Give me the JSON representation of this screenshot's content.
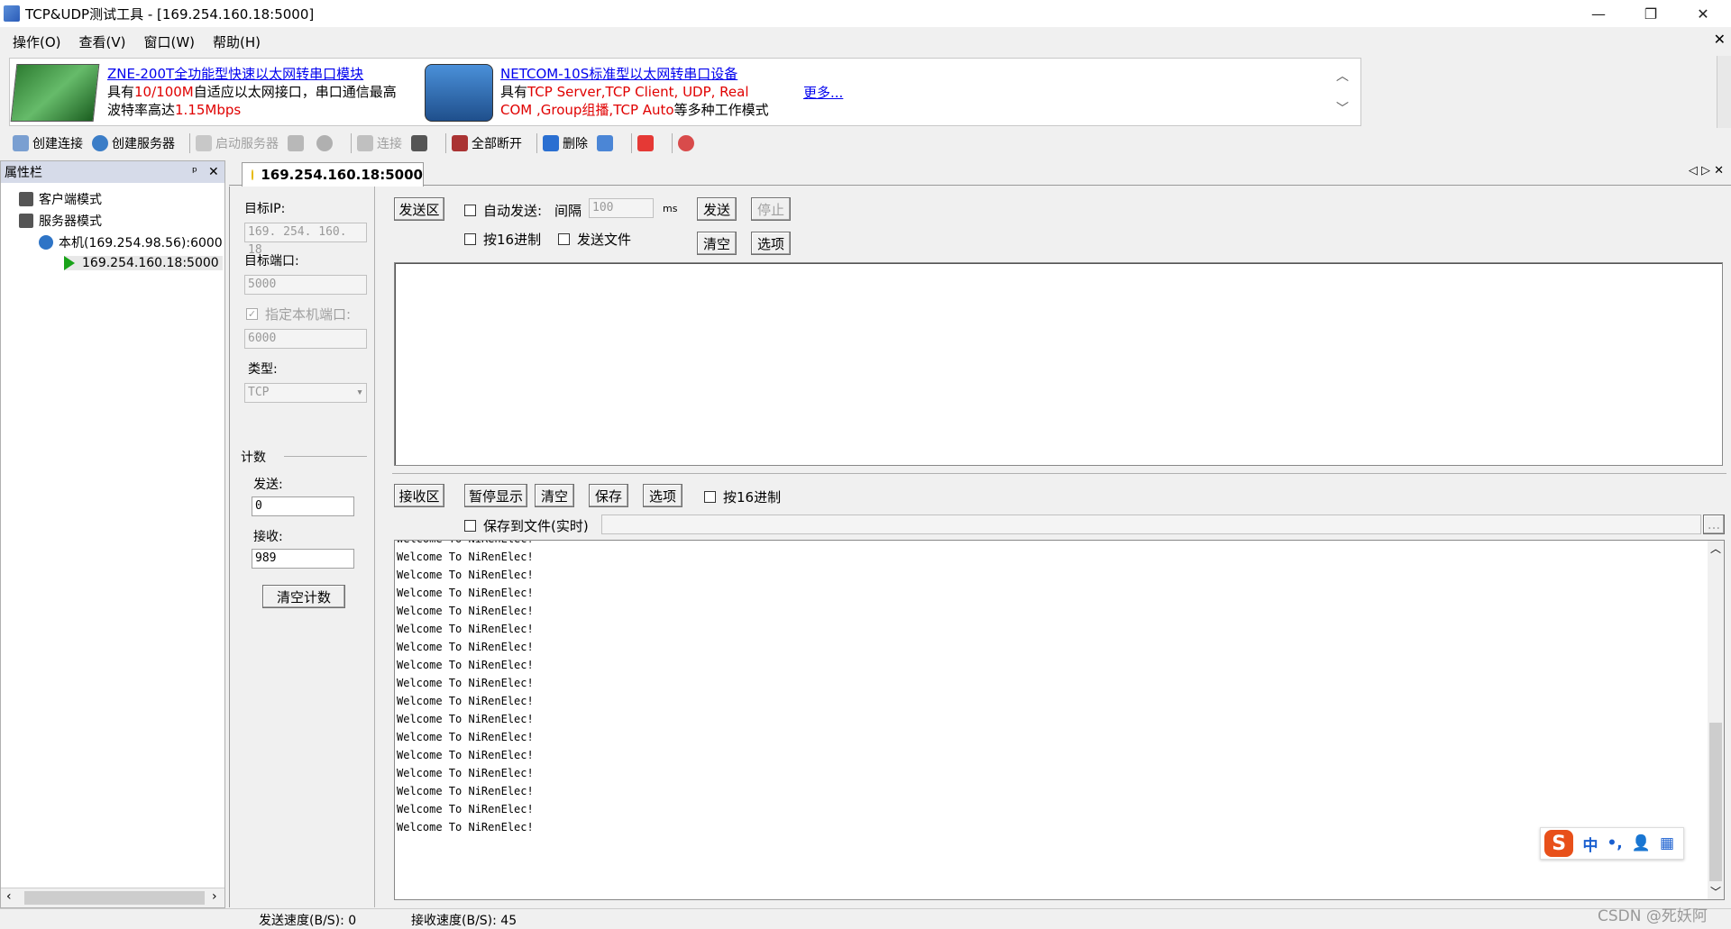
{
  "window": {
    "title": "TCP&UDP测试工具 - [169.254.160.18:5000]",
    "minimize": "—",
    "restore": "❐",
    "close": "✕"
  },
  "menu": {
    "items": [
      "操作(O)",
      "查看(V)",
      "窗口(W)",
      "帮助(H)"
    ],
    "mdi_close": "✕"
  },
  "ads": {
    "ad1_title": "ZNE-200T全功能型快速以太网转串口模块",
    "ad1_line2_a": "具有",
    "ad1_line2_b": "10/100M",
    "ad1_line2_c": "自适应以太网接口，串口通信最高",
    "ad1_line3_a": "波特率高达",
    "ad1_line3_b": "1.15Mbps",
    "ad2_title": "NETCOM-10S标准型以太网转串口设备",
    "ad2_line2_a": "具有",
    "ad2_line2_b": "TCP Server,TCP Client, UDP, Real",
    "ad2_line3_a": "COM ,Group组播,TCP Auto",
    "ad2_line3_b": "等多种工作模式",
    "more": "更多...",
    "scroll_up": "︿",
    "scroll_down": "﹀"
  },
  "toolbar": {
    "create_conn": "创建连接",
    "create_server": "创建服务器",
    "start_server": "启动服务器",
    "connect": "连接",
    "disconnect_all": "全部断开",
    "delete": "删除"
  },
  "sidebar": {
    "title": "属性栏",
    "pin": "ᵖ",
    "close": "✕",
    "client_mode": "客户端模式",
    "server_mode": "服务器模式",
    "local": "本机(169.254.98.56):6000",
    "remote": "169.254.160.18:5000",
    "scroll_left": "‹",
    "scroll_right": "›"
  },
  "tab": {
    "label": "169.254.160.18:5000",
    "nav": "◁ ▷ ✕"
  },
  "settings": {
    "target_ip_label": "目标IP:",
    "target_ip": "169. 254. 160. 18",
    "target_port_label": "目标端口:",
    "target_port": "5000",
    "local_port_chk": "指定本机端口:",
    "local_port": "6000",
    "type_label": "类型:",
    "type_value": "TCP",
    "count_label": "计数",
    "send_label": "发送:",
    "send_count": "0",
    "recv_label": "接收:",
    "recv_count": "989",
    "clear_count": "清空计数"
  },
  "send": {
    "area_btn": "发送区",
    "auto_send": "自动发送:",
    "interval_label": "间隔",
    "interval": "100",
    "ms": "ms",
    "send_btn": "发送",
    "stop_btn": "停止",
    "hex": "按16进制",
    "send_file": "发送文件",
    "clear_btn": "清空",
    "options_btn": "选项"
  },
  "receive": {
    "area_btn": "接收区",
    "pause": "暂停显示",
    "clear": "清空",
    "save": "保存",
    "options": "选项",
    "hex": "按16进制",
    "save_file": "保存到文件(实时)",
    "browse": "...",
    "lines": [
      "Welcome To NiRenElec!",
      "Welcome To NiRenElec!",
      "Welcome To NiRenElec!",
      "Welcome To NiRenElec!",
      "Welcome To NiRenElec!",
      "Welcome To NiRenElec!",
      "Welcome To NiRenElec!",
      "Welcome To NiRenElec!",
      "Welcome To NiRenElec!",
      "Welcome To NiRenElec!",
      "Welcome To NiRenElec!",
      "Welcome To NiRenElec!",
      "Welcome To NiRenElec!",
      "Welcome To NiRenElec!",
      "Welcome To NiRenElec!",
      "Welcome To NiRenElec!",
      "Welcome To NiRenElec!"
    ],
    "scroll_up": "︿",
    "scroll_down": "﹀"
  },
  "status": {
    "send_speed": "发送速度(B/S): 0",
    "recv_speed": "接收速度(B/S): 45"
  },
  "ime": {
    "logo": "S",
    "mode": "中",
    "punct": "•,",
    "user": "👤",
    "grid": "▦"
  },
  "watermark": "CSDN @死妖阿"
}
